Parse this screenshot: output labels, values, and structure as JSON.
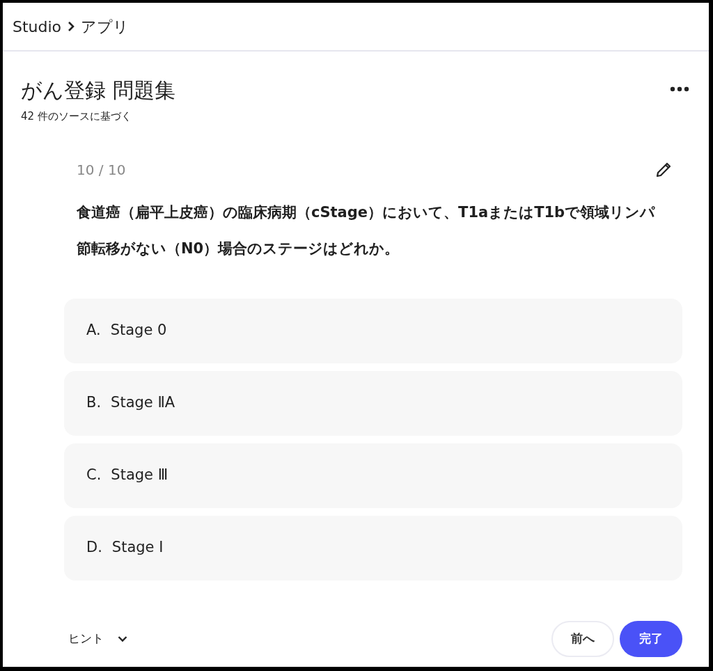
{
  "breadcrumb": [
    "Studio",
    "アプリ"
  ],
  "title": "がん登録 問題集",
  "subtitle": "42 件のソースに基づく",
  "counter": "10 / 10",
  "question": "食道癌（扁平上皮癌）の臨床病期（cStage）において、T1aまたはT1bで領域リンパ節転移がない（N0）場合のステージはどれか。",
  "options": [
    {
      "letter": "A.",
      "text": "Stage 0"
    },
    {
      "letter": "B.",
      "text": "Stage ⅡA"
    },
    {
      "letter": "C.",
      "text": "Stage Ⅲ"
    },
    {
      "letter": "D.",
      "text": "Stage Ⅰ"
    }
  ],
  "hint": "ヒント",
  "buttons": [
    {
      "label": "前へ",
      "kind": "secondary"
    },
    {
      "label": "完了",
      "kind": "primary"
    }
  ]
}
